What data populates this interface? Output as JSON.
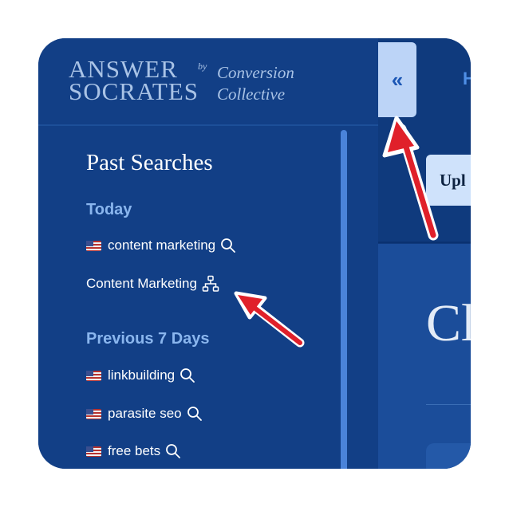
{
  "logo": {
    "line1": "ANSWER",
    "line2": "SOCRATES",
    "by": "by",
    "partner_line1": "Conversion",
    "partner_line2": "Collective"
  },
  "sidebar": {
    "heading": "Past Searches",
    "groups": [
      {
        "title": "Today",
        "items": [
          {
            "label": "content marketing",
            "flag": true,
            "icon": "search-icon"
          },
          {
            "label": "Content Marketing",
            "flag": false,
            "icon": "sitemap-icon"
          }
        ]
      },
      {
        "title": "Previous 7 Days",
        "items": [
          {
            "label": "linkbuilding",
            "flag": true,
            "icon": "search-icon"
          },
          {
            "label": "parasite seo",
            "flag": true,
            "icon": "search-icon"
          },
          {
            "label": "free bets",
            "flag": true,
            "icon": "search-icon"
          }
        ]
      }
    ]
  },
  "main": {
    "collapse_label": "«",
    "nav_partial": "H",
    "upload_partial": "Upl",
    "heading_partial": "Cl"
  },
  "colors": {
    "sidebar_bg": "#123f86",
    "accent_light": "#8ab6ee",
    "button_bg": "#bcd4f7",
    "annotation_arrow": "#e0202a"
  }
}
